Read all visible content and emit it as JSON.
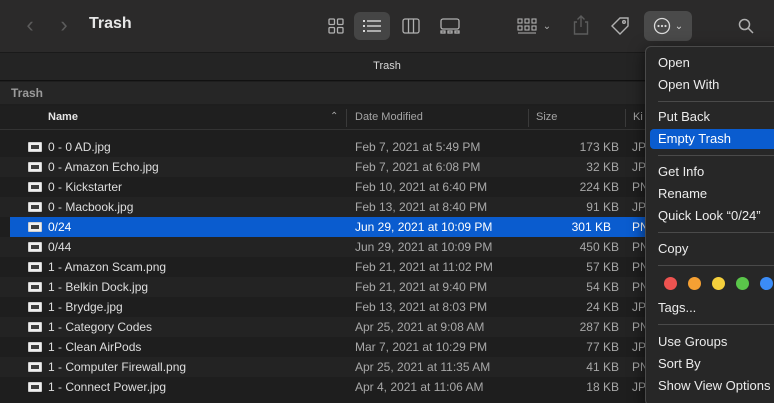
{
  "window": {
    "title": "Trash",
    "tab": "Trash",
    "path": "Trash"
  },
  "columns": {
    "name": "Name",
    "date": "Date Modified",
    "size": "Size",
    "kind": "Ki"
  },
  "files": [
    {
      "name": "0 - 0 AD.jpg",
      "date": "Feb 7, 2021 at 5:49 PM",
      "size": "173 KB",
      "kind": "JP"
    },
    {
      "name": "0 - Amazon Echo.jpg",
      "date": "Feb 7, 2021 at 6:08 PM",
      "size": "32 KB",
      "kind": "JP"
    },
    {
      "name": "0 - Kickstarter",
      "date": "Feb 10, 2021 at 6:40 PM",
      "size": "224 KB",
      "kind": "PN"
    },
    {
      "name": "0 - Macbook.jpg",
      "date": "Feb 13, 2021 at 8:40 PM",
      "size": "91 KB",
      "kind": "JP"
    },
    {
      "name": "0/24",
      "date": "Jun 29, 2021 at 10:09 PM",
      "size": "301 KB",
      "kind": "PN"
    },
    {
      "name": "0/44",
      "date": "Jun 29, 2021 at 10:09 PM",
      "size": "450 KB",
      "kind": "PN"
    },
    {
      "name": "1 - Amazon Scam.png",
      "date": "Feb 21, 2021 at 11:02 PM",
      "size": "57 KB",
      "kind": "PN"
    },
    {
      "name": "1 - Belkin Dock.jpg",
      "date": "Feb 21, 2021 at 9:40 PM",
      "size": "54 KB",
      "kind": "PN"
    },
    {
      "name": "1 - Brydge.jpg",
      "date": "Feb 13, 2021 at 8:03 PM",
      "size": "24 KB",
      "kind": "JP"
    },
    {
      "name": "1 - Category Codes",
      "date": "Apr 25, 2021 at 9:08 AM",
      "size": "287 KB",
      "kind": "PN"
    },
    {
      "name": "1 - Clean AirPods",
      "date": "Mar 7, 2021 at 10:29 PM",
      "size": "77 KB",
      "kind": "JP"
    },
    {
      "name": "1 - Computer Firewall.png",
      "date": "Apr 25, 2021 at 11:35 AM",
      "size": "41 KB",
      "kind": "PN"
    },
    {
      "name": "1 - Connect Power.jpg",
      "date": "Apr 4, 2021 at 11:06 AM",
      "size": "18 KB",
      "kind": "JP"
    }
  ],
  "selected_index": 4,
  "context_menu": {
    "open": "Open",
    "open_with": "Open With",
    "put_back": "Put Back",
    "empty_trash": "Empty Trash",
    "get_info": "Get Info",
    "rename": "Rename",
    "quick_look": "Quick Look “0/24”",
    "copy": "Copy",
    "tags": "Tags...",
    "use_groups": "Use Groups",
    "sort_by": "Sort By",
    "show_view_options": "Show View Options"
  },
  "tag_colors": [
    "#ee5350",
    "#f5a033",
    "#f5d03c",
    "#5ac64a",
    "#3b8cf7"
  ],
  "icons": {
    "back": "chevron-left-icon",
    "forward": "chevron-right-icon",
    "sort": "chevron-up-icon"
  }
}
